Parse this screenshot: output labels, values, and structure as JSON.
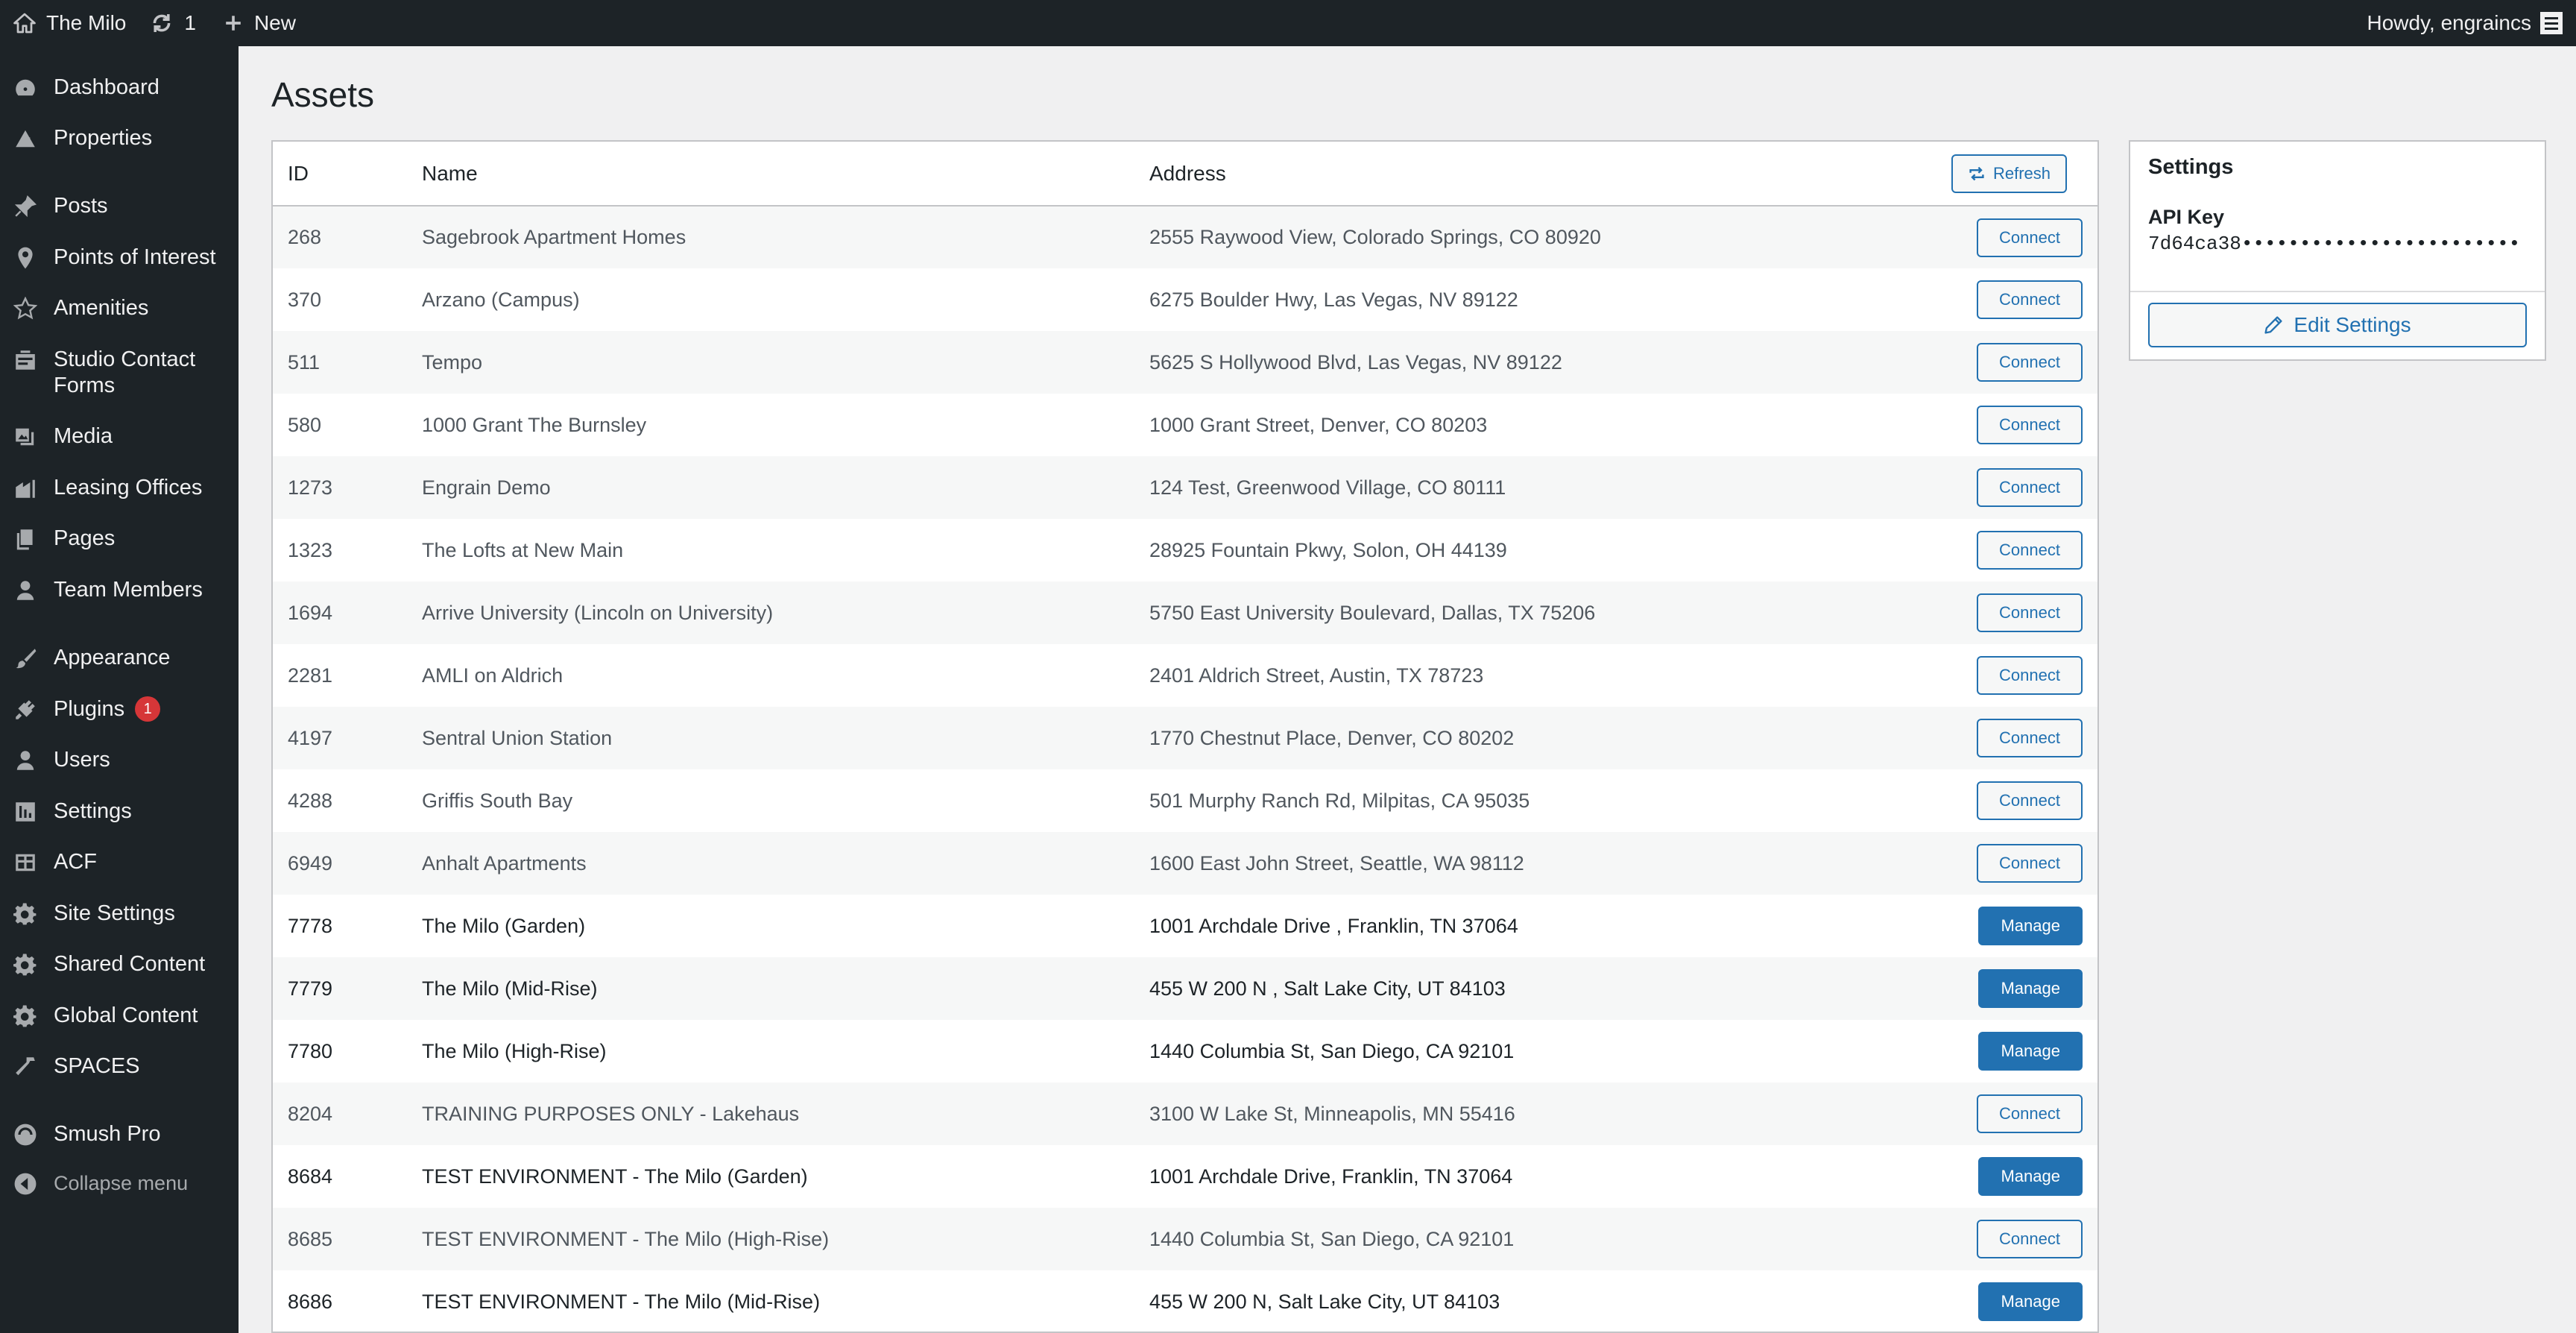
{
  "admin_bar": {
    "site_name": "The Milo",
    "updates_count": "1",
    "new_label": "New",
    "greeting": "Howdy, engraincs"
  },
  "menu": {
    "items": [
      {
        "label": "Dashboard",
        "icon": "dashboard-icon"
      },
      {
        "label": "Properties",
        "icon": "properties-icon"
      },
      {
        "label": "Posts",
        "icon": "pushpin-icon"
      },
      {
        "label": "Points of Interest",
        "icon": "location-pin-icon"
      },
      {
        "label": "Amenities",
        "icon": "star-icon"
      },
      {
        "label": "Studio Contact Forms",
        "icon": "forms-icon"
      },
      {
        "label": "Media",
        "icon": "media-icon"
      },
      {
        "label": "Leasing Offices",
        "icon": "building-icon"
      },
      {
        "label": "Pages",
        "icon": "pages-icon"
      },
      {
        "label": "Team Members",
        "icon": "person-icon"
      },
      {
        "label": "Appearance",
        "icon": "paintbrush-icon"
      },
      {
        "label": "Plugins",
        "icon": "plug-icon",
        "badge": "1"
      },
      {
        "label": "Users",
        "icon": "users-icon"
      },
      {
        "label": "Settings",
        "icon": "settings-icon"
      },
      {
        "label": "ACF",
        "icon": "acf-icon"
      },
      {
        "label": "Site Settings",
        "icon": "gear-icon"
      },
      {
        "label": "Shared Content",
        "icon": "gear-icon"
      },
      {
        "label": "Global Content",
        "icon": "gear-icon"
      },
      {
        "label": "SPACES",
        "icon": "hammer-icon"
      },
      {
        "label": "Smush Pro",
        "icon": "smush-icon"
      }
    ],
    "collapse_label": "Collapse menu"
  },
  "page": {
    "title": "Assets"
  },
  "table": {
    "columns": [
      "ID",
      "Name",
      "Address"
    ],
    "refresh_label": "Refresh",
    "rows": [
      {
        "id": "268",
        "name": "Sagebrook Apartment Homes",
        "address": "2555 Raywood View, Colorado Springs, CO 80920",
        "action": "Connect"
      },
      {
        "id": "370",
        "name": "Arzano (Campus)",
        "address": "6275 Boulder Hwy, Las Vegas, NV 89122",
        "action": "Connect"
      },
      {
        "id": "511",
        "name": "Tempo",
        "address": "5625 S Hollywood Blvd, Las Vegas, NV 89122",
        "action": "Connect"
      },
      {
        "id": "580",
        "name": "1000 Grant The Burnsley",
        "address": "1000 Grant Street, Denver, CO 80203",
        "action": "Connect"
      },
      {
        "id": "1273",
        "name": "Engrain Demo",
        "address": "124 Test, Greenwood Village, CO 80111",
        "action": "Connect"
      },
      {
        "id": "1323",
        "name": "The Lofts at New Main",
        "address": "28925 Fountain Pkwy, Solon, OH 44139",
        "action": "Connect"
      },
      {
        "id": "1694",
        "name": "Arrive University (Lincoln on University)",
        "address": "5750 East University Boulevard, Dallas, TX 75206",
        "action": "Connect"
      },
      {
        "id": "2281",
        "name": "AMLI on Aldrich",
        "address": "2401 Aldrich Street, Austin, TX 78723",
        "action": "Connect"
      },
      {
        "id": "4197",
        "name": "Sentral Union Station",
        "address": "1770 Chestnut Place, Denver, CO 80202",
        "action": "Connect"
      },
      {
        "id": "4288",
        "name": "Griffis South Bay",
        "address": "501 Murphy Ranch Rd, Milpitas, CA 95035",
        "action": "Connect"
      },
      {
        "id": "6949",
        "name": "Anhalt Apartments",
        "address": "1600 East John Street, Seattle, WA 98112",
        "action": "Connect"
      },
      {
        "id": "7778",
        "name": "The Milo (Garden)",
        "address": "1001 Archdale Drive , Franklin, TN 37064",
        "action": "Manage"
      },
      {
        "id": "7779",
        "name": "The Milo (Mid-Rise)",
        "address": "455 W 200 N , Salt Lake City, UT 84103",
        "action": "Manage"
      },
      {
        "id": "7780",
        "name": "The Milo (High-Rise)",
        "address": "1440 Columbia St, San Diego, CA 92101",
        "action": "Manage"
      },
      {
        "id": "8204",
        "name": "TRAINING PURPOSES ONLY - Lakehaus",
        "address": "3100 W Lake St, Minneapolis, MN 55416",
        "action": "Connect"
      },
      {
        "id": "8684",
        "name": "TEST ENVIRONMENT - The Milo (Garden)",
        "address": "1001 Archdale Drive, Franklin, TN 37064",
        "action": "Manage"
      },
      {
        "id": "8685",
        "name": "TEST ENVIRONMENT - The Milo (High-Rise)",
        "address": "1440 Columbia St, San Diego, CA 92101",
        "action": "Connect"
      },
      {
        "id": "8686",
        "name": "TEST ENVIRONMENT - The Milo (Mid-Rise)",
        "address": "455 W 200 N, Salt Lake City, UT 84103",
        "action": "Manage"
      }
    ]
  },
  "settings": {
    "title": "Settings",
    "api_key_label": "API Key",
    "api_key_value": "7d64ca38••••••••••••••••••••••••",
    "edit_label": "Edit Settings"
  },
  "colors": {
    "admin_bg": "#1d2327",
    "accent": "#2271b1",
    "badge": "#d63638"
  }
}
